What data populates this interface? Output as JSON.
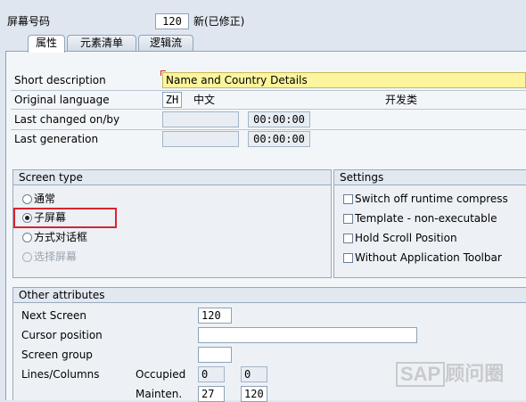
{
  "header": {
    "screen_number_label": "屏幕号码",
    "screen_number_value": "120",
    "status": "新(已修正)"
  },
  "tabs": [
    {
      "label": "属性",
      "active": true
    },
    {
      "label": "元素清单",
      "active": false
    },
    {
      "label": "逻辑流",
      "active": false
    }
  ],
  "attributes": {
    "short_description_label": "Short description",
    "short_description_value": "Name and Country Details",
    "original_language_label": "Original language",
    "language_code": "ZH",
    "language_name": "中文",
    "dev_class_label": "开发类",
    "last_changed_label": "Last changed on/by",
    "last_changed_date": "",
    "last_changed_time": "00:00:00",
    "last_generation_label": "Last generation",
    "last_generation_date": "",
    "last_generation_time": "00:00:00"
  },
  "screen_type": {
    "title": "Screen type",
    "options": [
      {
        "label": "通常",
        "selected": false,
        "enabled": true
      },
      {
        "label": "子屏幕",
        "selected": true,
        "enabled": true
      },
      {
        "label": "方式对话框",
        "selected": false,
        "enabled": true
      },
      {
        "label": "选择屏幕",
        "selected": false,
        "enabled": false
      }
    ],
    "highlight_color": "#d9232d"
  },
  "settings": {
    "title": "Settings",
    "options": [
      {
        "label": "Switch off runtime compress",
        "checked": false
      },
      {
        "label": "Template - non-executable",
        "checked": false
      },
      {
        "label": "Hold Scroll Position",
        "checked": false
      },
      {
        "label": "Without Application Toolbar",
        "checked": false
      }
    ]
  },
  "other_attributes": {
    "title": "Other attributes",
    "next_screen_label": "Next Screen",
    "next_screen_value": "120",
    "cursor_position_label": "Cursor position",
    "cursor_position_value": "",
    "screen_group_label": "Screen group",
    "screen_group_value": "",
    "lines_columns_label": "Lines/Columns",
    "occupied_label": "Occupied",
    "occupied_lines": "0",
    "occupied_columns": "0",
    "mainten_label": "Mainten.",
    "mainten_lines": "27",
    "mainten_columns": "120"
  },
  "watermark": {
    "text": "SAP",
    "suffix": "顾问圈"
  }
}
